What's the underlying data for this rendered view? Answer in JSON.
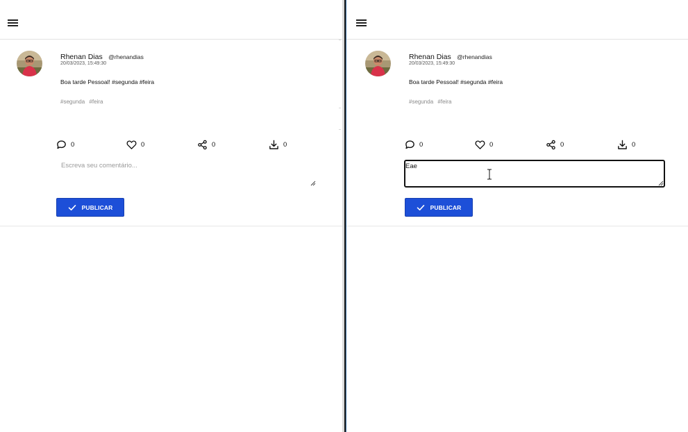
{
  "panes": [
    {
      "post": {
        "author_name": "Rhenan Dias",
        "author_handle": "@rhenandias",
        "date": "20/03/2023, 15:49:30",
        "text": "Boa tarde Pessoal! #segunda #feira",
        "tags": [
          "#segunda",
          "#feira"
        ],
        "actions": [
          {
            "icon": "comment-icon",
            "count": "0"
          },
          {
            "icon": "heart-icon",
            "count": "0"
          },
          {
            "icon": "share-icon",
            "count": "0"
          },
          {
            "icon": "download-icon",
            "count": "0"
          }
        ]
      },
      "comment": {
        "placeholder": "Escreva seu comentário...",
        "value": ""
      },
      "publish_label": "PUBLICAR"
    },
    {
      "post": {
        "author_name": "Rhenan Dias",
        "author_handle": "@rhenandias",
        "date": "20/03/2023, 15:49:30",
        "text": "Boa tarde Pessoal! #segunda #feira",
        "tags": [
          "#segunda",
          "#feira"
        ],
        "actions": [
          {
            "icon": "comment-icon",
            "count": "0"
          },
          {
            "icon": "heart-icon",
            "count": "0"
          },
          {
            "icon": "share-icon",
            "count": "0"
          },
          {
            "icon": "download-icon",
            "count": "0"
          }
        ]
      },
      "comment": {
        "placeholder": "",
        "value": "Eae"
      },
      "publish_label": "PUBLICAR"
    }
  ],
  "colors": {
    "accent": "#1d4fd8",
    "muted_text": "#8a8a8a"
  }
}
